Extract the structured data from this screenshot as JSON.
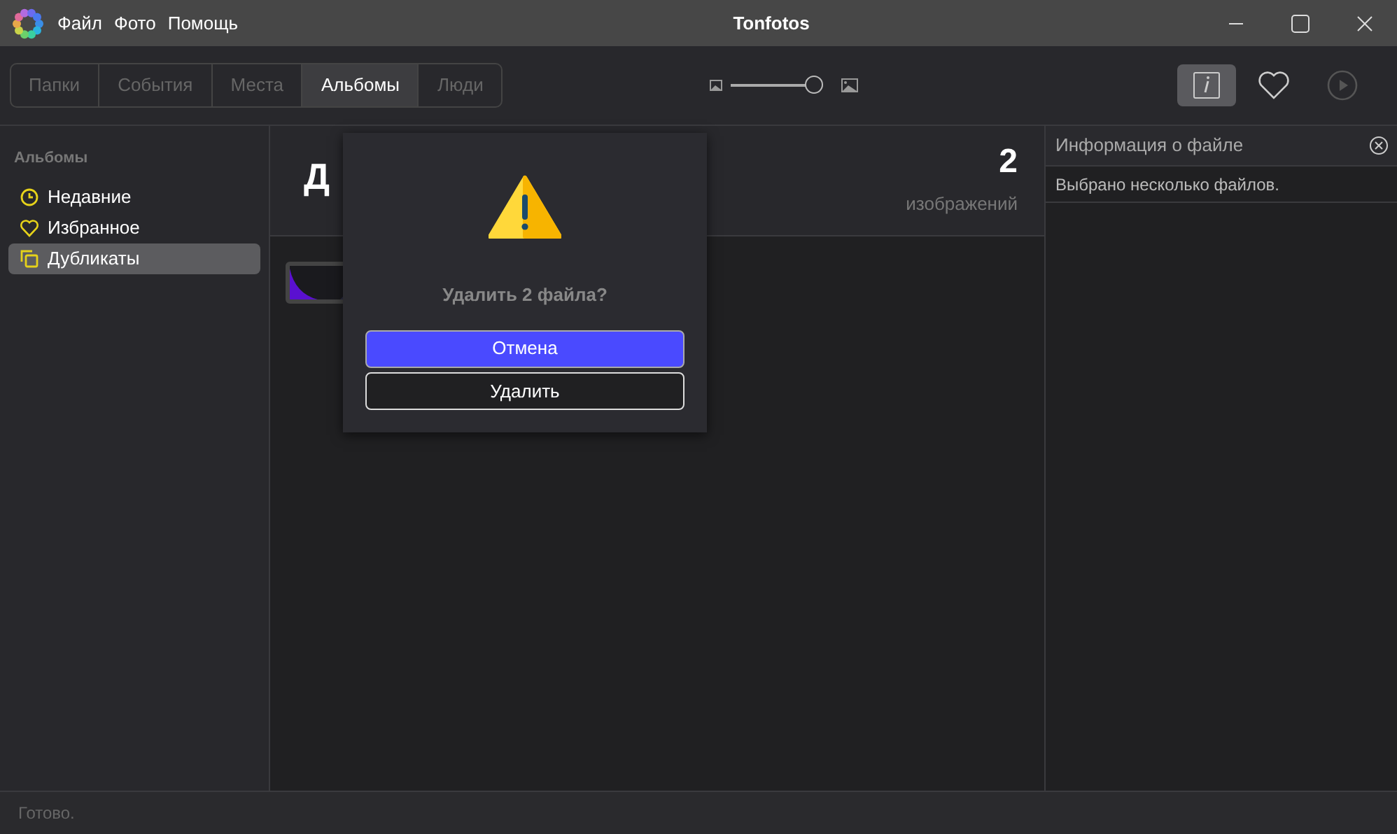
{
  "window": {
    "title": "Tonfotos"
  },
  "menu": [
    "Файл",
    "Фото",
    "Помощь"
  ],
  "tabs": [
    {
      "label": "Папки",
      "selected": false
    },
    {
      "label": "События",
      "selected": false
    },
    {
      "label": "Места",
      "selected": false
    },
    {
      "label": "Альбомы",
      "selected": true
    },
    {
      "label": "Люди",
      "selected": false
    }
  ],
  "zoom_slider": {
    "level": 1
  },
  "toolbar": {
    "info_on": true,
    "favorite_on": false
  },
  "sidebar": {
    "heading": "Альбомы",
    "items": [
      {
        "label": "Недавние",
        "kind": "clock",
        "selected": false
      },
      {
        "label": "Избранное",
        "kind": "heart",
        "selected": false
      },
      {
        "label": "Дубликаты",
        "kind": "copies",
        "selected": true
      }
    ]
  },
  "album": {
    "title": "Д",
    "count": "2",
    "count_label": "изображений"
  },
  "dialog": {
    "message": "Удалить 2 файла?",
    "buttons": [
      {
        "label": "Отмена",
        "primary": true
      },
      {
        "label": "Удалить",
        "primary": false
      }
    ]
  },
  "info_panel": {
    "title": "Информация о файле",
    "text": "Выбрано несколько файлов."
  },
  "status_bar": "Готово."
}
